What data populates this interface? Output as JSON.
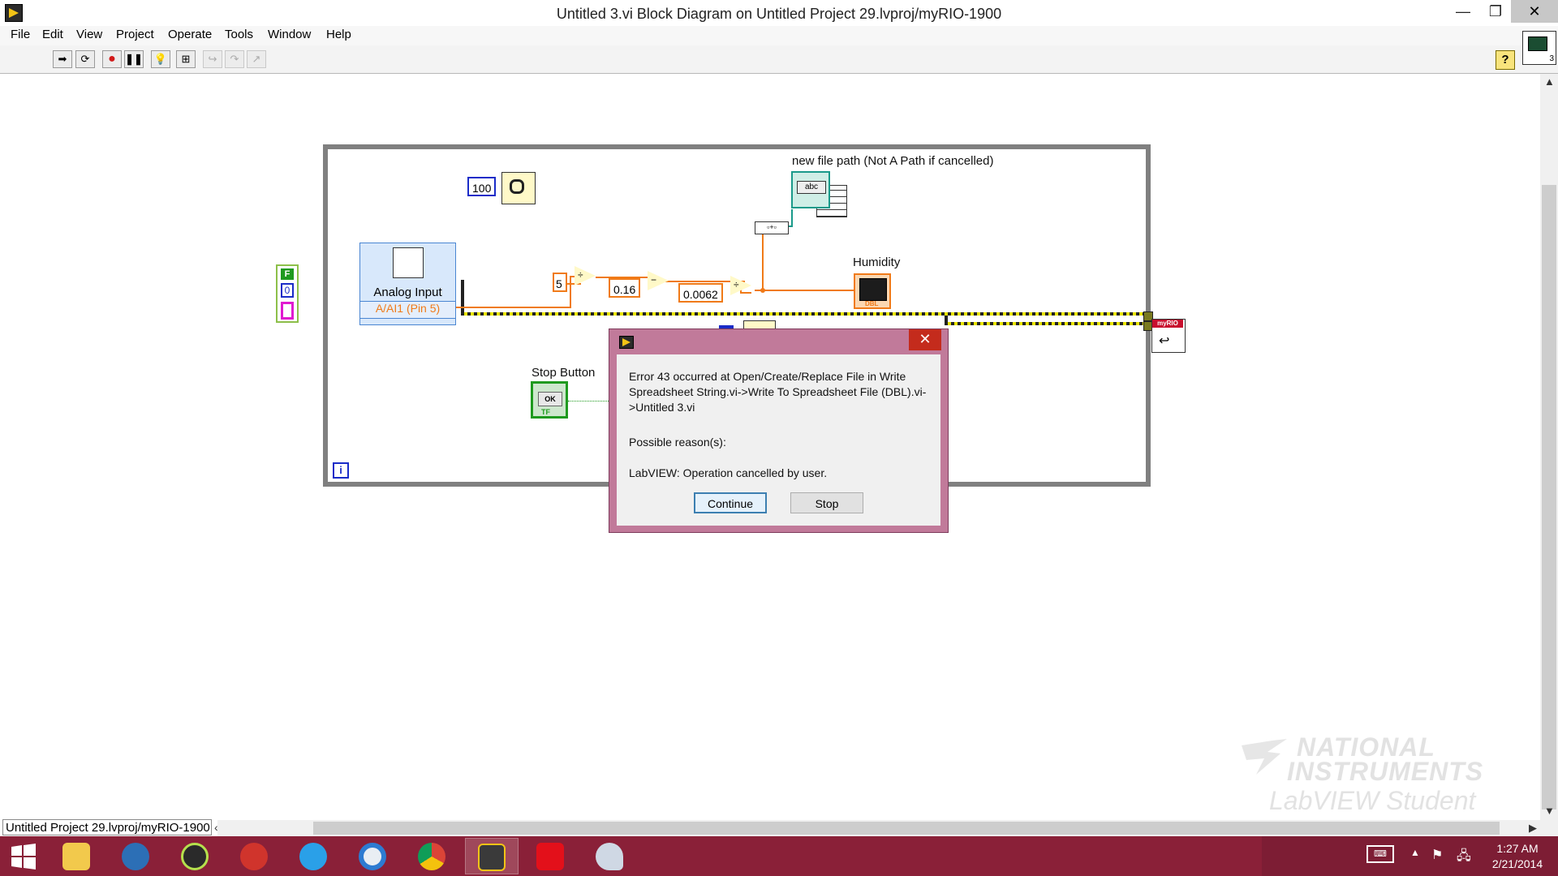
{
  "window": {
    "title": "Untitled 3.vi Block Diagram on Untitled Project 29.lvproj/myRIO-1900",
    "minimize": "—",
    "maximize": "❐",
    "close": "✕"
  },
  "menu": [
    "File",
    "Edit",
    "View",
    "Project",
    "Operate",
    "Tools",
    "Window",
    "Help"
  ],
  "toolbar": {
    "buttons": [
      "run-arrow",
      "run-continuously",
      "abort",
      "pause",
      "highlight-execution",
      "retain-wire-values",
      "step-into",
      "step-over",
      "step-out"
    ],
    "help": "?",
    "vi_icon_number": "3"
  },
  "diagram": {
    "wait_constant": "100",
    "analog_input": {
      "name": "Analog Input",
      "channel": "A/AI1 (Pin 5)"
    },
    "constants": {
      "c1": "5",
      "c2": "0.16",
      "c3": "0.0062"
    },
    "labels": {
      "file_path": "new file path (Not A Path if cancelled)",
      "humidity": "Humidity",
      "stop_button": "Stop Button"
    },
    "stop_ok": "OK",
    "stop_tf": "TF",
    "iteration": "i",
    "bool_f": "F",
    "bool_zero": "0",
    "humidity_dbl": "DBL",
    "filepath_abc": "abc",
    "myrio_badge": "myRIO",
    "bundle": "▫+▫"
  },
  "dialog": {
    "message": "Error 43 occurred at Open/Create/Replace File in Write Spreadsheet String.vi->Write To Spreadsheet File (DBL).vi->Untitled 3.vi",
    "reasons_title": "Possible reason(s):",
    "reason": "LabVIEW:  Operation cancelled by user.",
    "continue_label": "Continue",
    "stop_label": "Stop",
    "close": "✕"
  },
  "status": {
    "context_path": "Untitled Project 29.lvproj/myRIO-1900"
  },
  "watermark": {
    "line1": "NATIONAL",
    "line2": "INSTRUMENTS",
    "line3": "LabVIEW Student Edition"
  },
  "taskbar": {
    "apps": [
      "file-explorer",
      "media-center",
      "itunes",
      "audio-app",
      "internet-explorer",
      "disc-app",
      "chrome",
      "labview",
      "adobe-reader",
      "paint"
    ],
    "time": "1:27 AM",
    "date": "2/21/2014"
  },
  "colors": {
    "taskbar": "#8a2038",
    "dialog_frame": "#c17a9a",
    "orange_wire": "#f07a18",
    "loop_border": "#808080"
  }
}
